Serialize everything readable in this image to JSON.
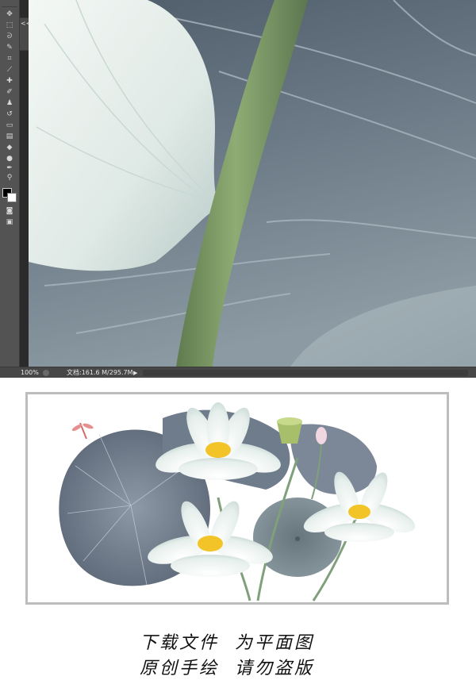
{
  "editor": {
    "tools": [
      "move-tool",
      "marquee-tool",
      "lasso-tool",
      "quick-select-tool",
      "crop-tool",
      "eyedropper-tool",
      "healing-tool",
      "brush-tool",
      "clone-stamp-tool",
      "history-brush-tool",
      "eraser-tool",
      "gradient-tool",
      "blur-tool",
      "dodge-tool",
      "pen-tool",
      "type-tool",
      "path-select-tool",
      "shape-tool",
      "hand-tool",
      "zoom-tool"
    ],
    "collapse_glyph": "<<",
    "colors": {
      "foreground": "#000000",
      "background": "#ffffff",
      "panel": "#535353"
    },
    "status": {
      "zoom": "100%",
      "doc_info": "文档:161.6 M/295.7M",
      "arrow": "▶"
    }
  },
  "preview": {
    "elements": [
      "dragonfly",
      "lotus-leaf",
      "lotus-flower",
      "lotus-seedpod",
      "lotus-bud"
    ]
  },
  "footer": {
    "line1": "下载文件  为平面图",
    "line2": "原创手绘  请勿盗版"
  }
}
